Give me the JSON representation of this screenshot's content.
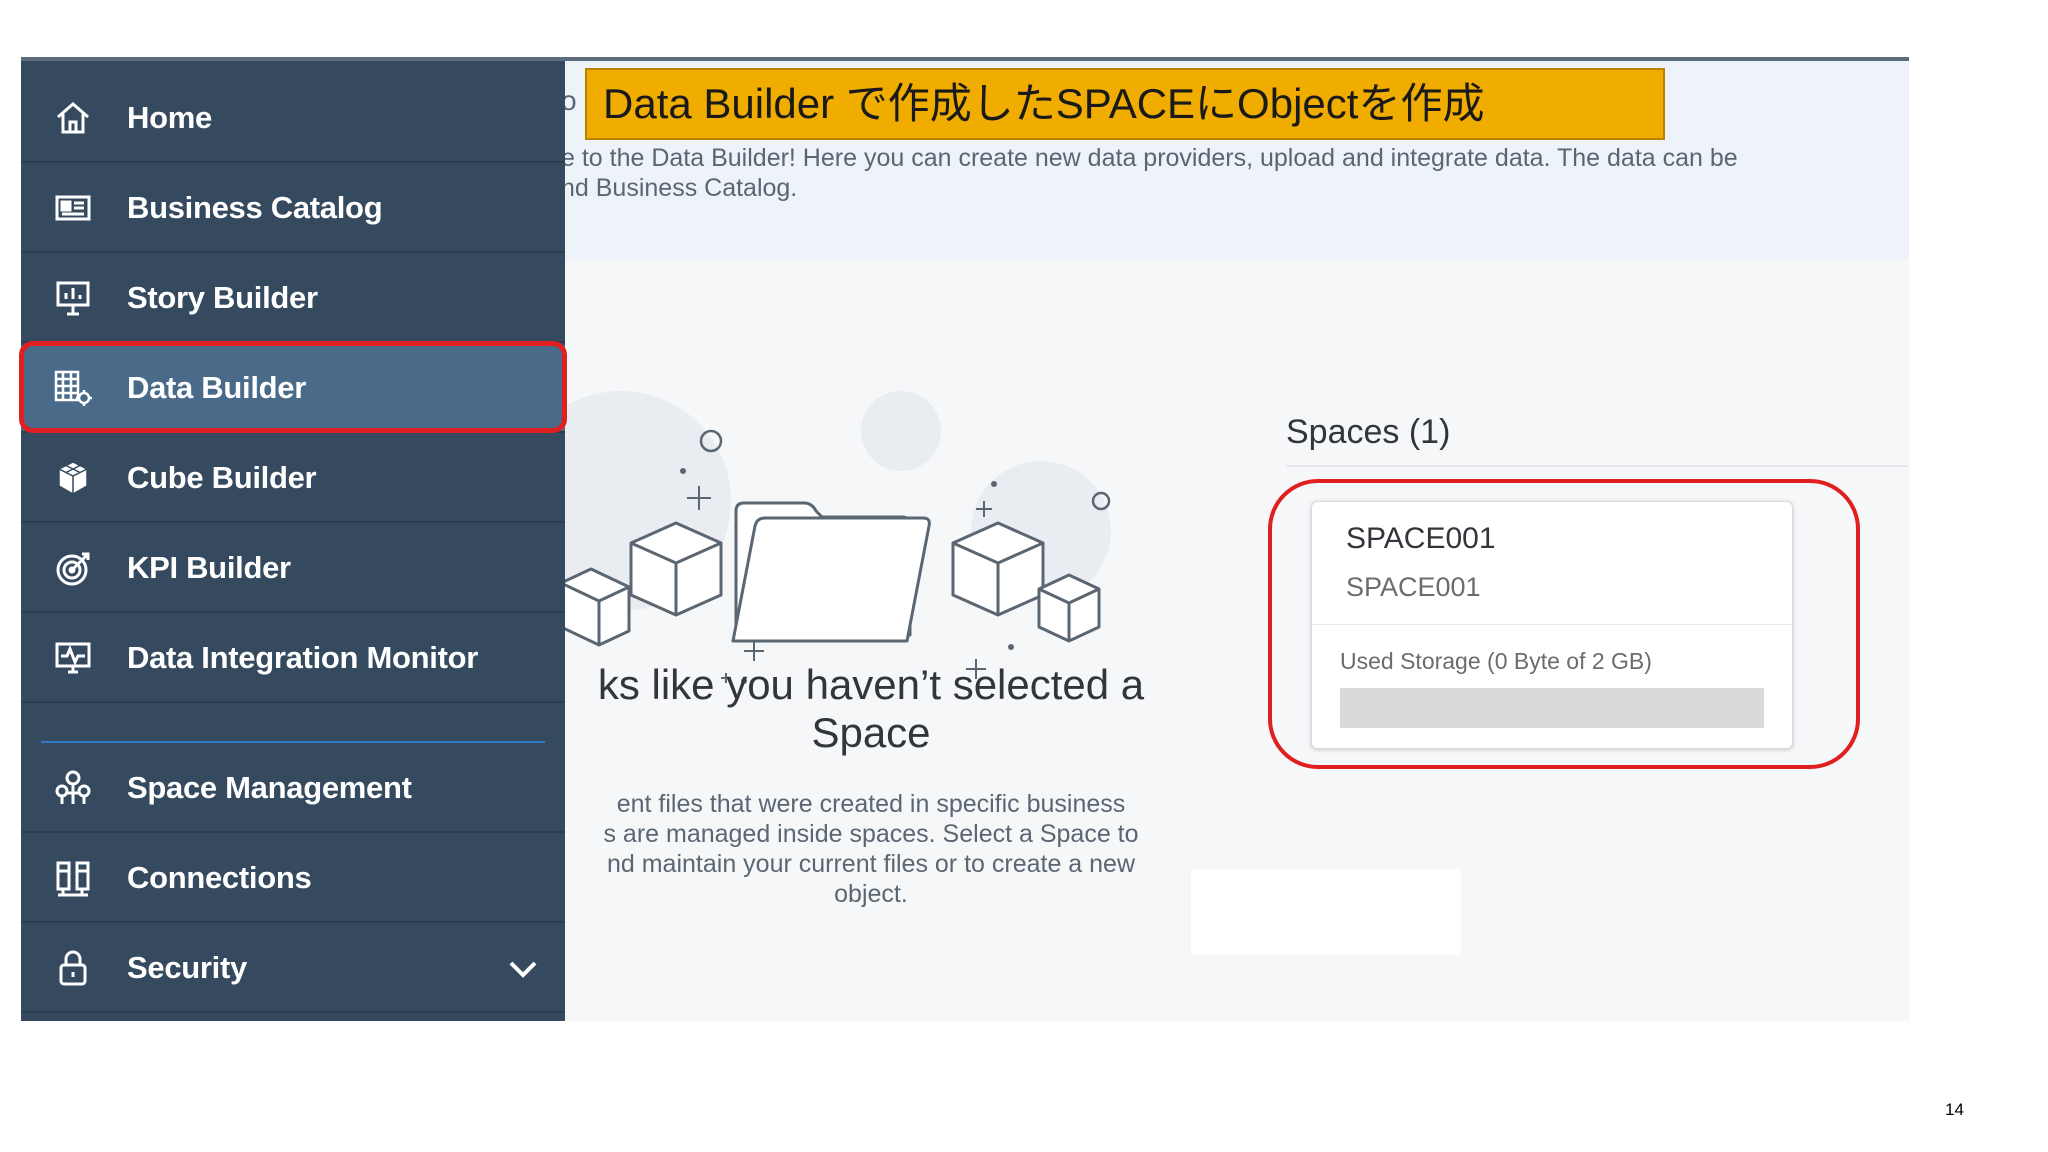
{
  "callout": {
    "text": "Data Builder で作成したSPACEにObjectを作成"
  },
  "header": {
    "title_fragment": "o",
    "intro_text": "e to the Data Builder! Here you can create new data providers, upload and integrate data. The data can be\nnd Business Catalog."
  },
  "sidebar": {
    "items": [
      {
        "label": "Home",
        "icon": "home-icon"
      },
      {
        "label": "Business Catalog",
        "icon": "catalog-icon"
      },
      {
        "label": "Story Builder",
        "icon": "story-icon"
      },
      {
        "label": "Data Builder",
        "icon": "data-builder-icon",
        "selected": true
      },
      {
        "label": "Cube Builder",
        "icon": "cube-icon"
      },
      {
        "label": "KPI Builder",
        "icon": "target-icon"
      },
      {
        "label": "Data Integration Monitor",
        "icon": "monitor-icon"
      },
      {
        "label": "Space Management",
        "icon": "space-management-icon"
      },
      {
        "label": "Connections",
        "icon": "connections-icon"
      },
      {
        "label": "Security",
        "icon": "lock-icon",
        "expandable": true
      }
    ]
  },
  "empty_state": {
    "title": "ks like you haven’t selected a\nSpace",
    "description": "ent files that were created in specific business\ns are managed inside spaces. Select a Space to\nnd maintain your current files or to create a new\nobject."
  },
  "spaces": {
    "heading": "Spaces (1)",
    "cards": [
      {
        "name": "SPACE001",
        "sub": "SPACE001",
        "storage": "Used Storage (0 Byte of 2 GB)",
        "used_fraction": 0
      }
    ]
  },
  "page_number": "14",
  "colors": {
    "sidebar": "#354a5f",
    "selected": "#4a6a8a",
    "highlight": "#e02020",
    "callout": "#f0ad00"
  }
}
